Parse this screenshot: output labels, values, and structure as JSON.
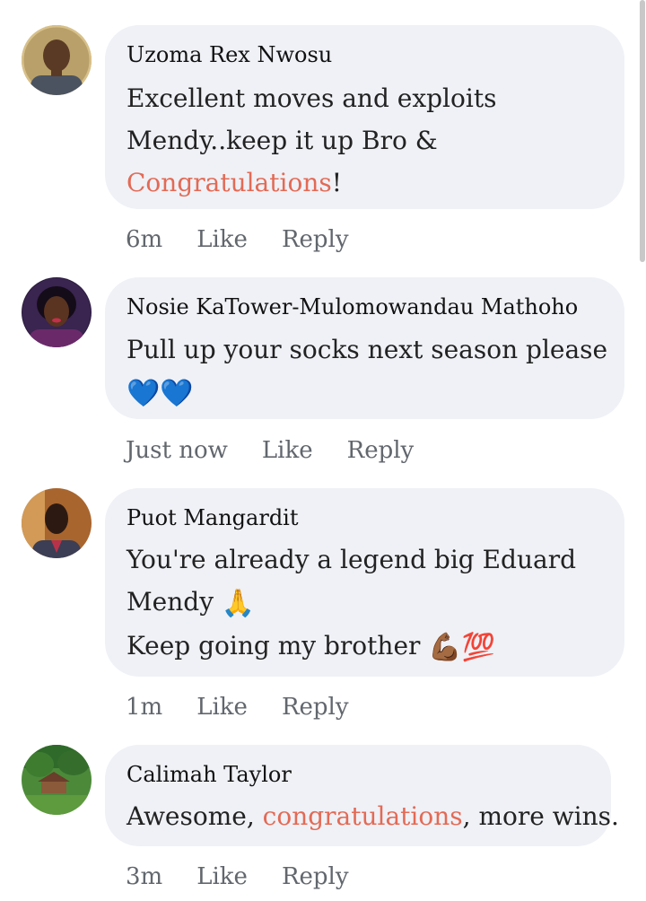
{
  "comments": [
    {
      "author": "Uzoma Rex Nwosu",
      "lines": [
        "Excellent moves and exploits",
        "Mendy..keep it up Bro &"
      ],
      "highlight": "Congratulations",
      "tail": "!",
      "time": "6m",
      "like": "Like",
      "reply": "Reply"
    },
    {
      "author": "Nosie KaTower-Mulomowandau Mathoho",
      "lines": [
        "Pull up your socks next season please"
      ],
      "emoji": "💙💙",
      "time": "Just now",
      "like": "Like",
      "reply": "Reply"
    },
    {
      "author": "Puot Mangardit",
      "line1": "You're already a legend big Eduard",
      "line2": "Mendy",
      "emoji2": "🙏",
      "line3": "Keep going my brother",
      "emoji3": "💪🏾💯",
      "time": "1m",
      "like": "Like",
      "reply": "Reply"
    },
    {
      "author": "Calimah Taylor",
      "before": "Awesome, ",
      "highlight": "congratulations",
      "after": ", more wins.",
      "time": "3m",
      "like": "Like",
      "reply": "Reply"
    }
  ],
  "colors": {
    "bubble": "#eff1f6",
    "highlight": "#e36a55",
    "meta": "#62676e"
  },
  "icons": [
    "avatar-uzoma",
    "avatar-nosie",
    "avatar-puot",
    "avatar-calimah"
  ]
}
